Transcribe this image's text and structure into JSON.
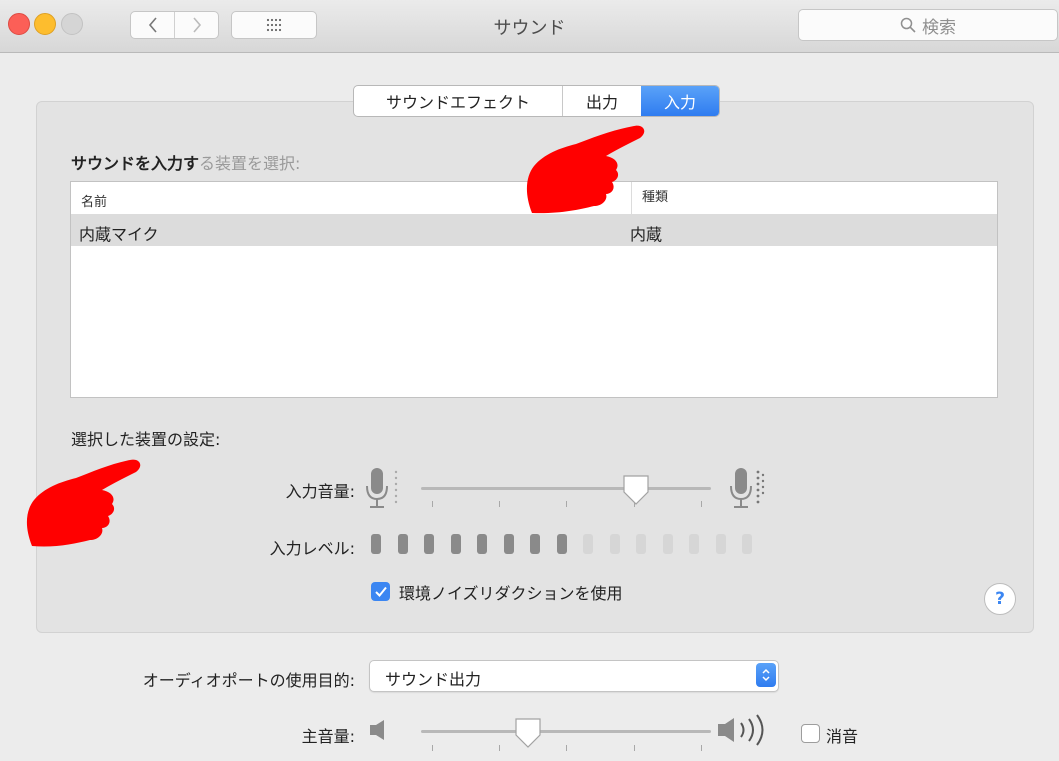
{
  "window": {
    "title": "サウンド",
    "search_placeholder": "検索"
  },
  "tabs": [
    {
      "label": "サウンドエフェクト",
      "selected": false
    },
    {
      "label": "出力",
      "selected": false
    },
    {
      "label": "入力",
      "selected": true
    }
  ],
  "input_section": {
    "heading_bold": "サウンドを入力す",
    "heading_faded": "る装置を選択:",
    "columns": [
      "名前",
      "種類"
    ],
    "devices": [
      {
        "name": "内蔵マイク",
        "type": "内蔵",
        "selected": true
      }
    ]
  },
  "device_settings": {
    "heading": "選択した装置の設定:",
    "input_volume_label": "入力音量:",
    "input_volume_value": 0.74,
    "input_level_label": "入力レベル:",
    "input_level_segments": 15,
    "input_level_active": 8,
    "noise_reduction_label": "環境ノイズリダクションを使用",
    "noise_reduction_checked": true,
    "help_label": "?"
  },
  "audio_port": {
    "label": "オーディオポートの使用目的:",
    "value": "サウンド出力"
  },
  "master": {
    "label": "主音量:",
    "value": 0.37,
    "mute_label": "消音",
    "mute_checked": false
  },
  "colors": {
    "accent": "#3b86f2",
    "pointer": "#ff0000"
  }
}
